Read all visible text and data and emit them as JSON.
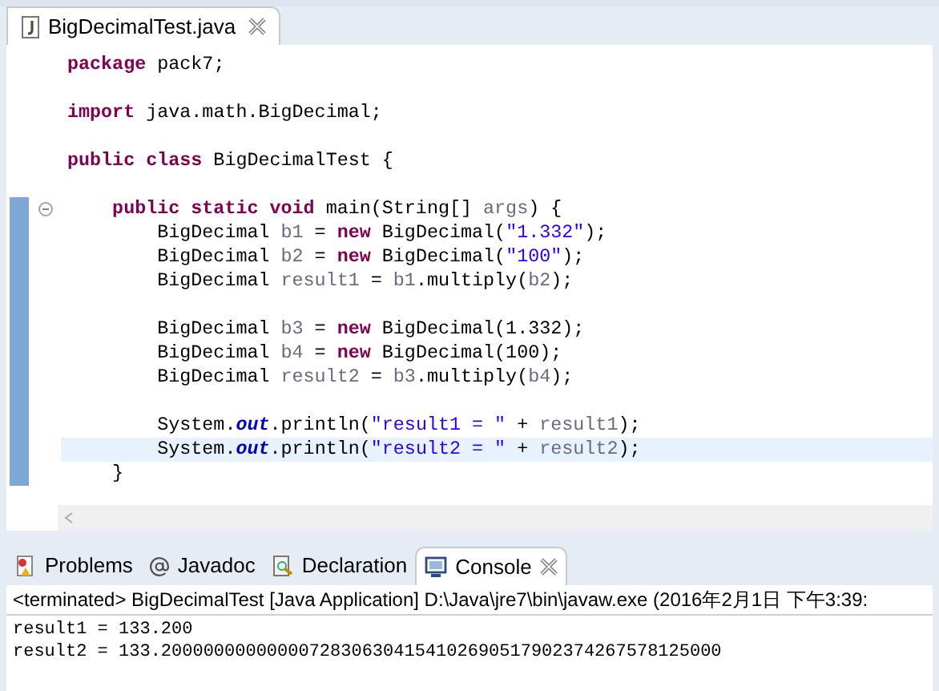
{
  "editor_tab": {
    "title": "BigDecimalTest.java"
  },
  "code_lines": [
    {
      "kind": "code",
      "current": false,
      "in_range": false,
      "foldable": false,
      "segments": [
        {
          "text": "package",
          "kind": "kw"
        },
        {
          "text": " pack7;",
          "kind": "plain"
        }
      ]
    },
    {
      "kind": "blank",
      "current": false,
      "in_range": false,
      "foldable": false
    },
    {
      "kind": "code",
      "current": false,
      "in_range": false,
      "foldable": false,
      "segments": [
        {
          "text": "import",
          "kind": "kw"
        },
        {
          "text": " java.math.BigDecimal;",
          "kind": "plain"
        }
      ]
    },
    {
      "kind": "blank",
      "current": false,
      "in_range": false,
      "foldable": false
    },
    {
      "kind": "code",
      "current": false,
      "in_range": false,
      "foldable": false,
      "segments": [
        {
          "text": "public class",
          "kind": "kw"
        },
        {
          "text": " BigDecimalTest {",
          "kind": "plain"
        }
      ]
    },
    {
      "kind": "blank",
      "current": false,
      "in_range": false,
      "foldable": false
    },
    {
      "kind": "code",
      "current": false,
      "in_range": true,
      "foldable": true,
      "segments": [
        {
          "text": "    public static void",
          "kind": "kw"
        },
        {
          "text": " main(String[] ",
          "kind": "plain"
        },
        {
          "text": "args",
          "kind": "var"
        },
        {
          "text": ") {",
          "kind": "plain"
        }
      ]
    },
    {
      "kind": "code",
      "current": false,
      "in_range": true,
      "foldable": false,
      "segments": [
        {
          "text": "        BigDecimal ",
          "kind": "plain"
        },
        {
          "text": "b1",
          "kind": "var"
        },
        {
          "text": " = ",
          "kind": "plain"
        },
        {
          "text": "new",
          "kind": "kw"
        },
        {
          "text": " BigDecimal(",
          "kind": "plain"
        },
        {
          "text": "\"1.332\"",
          "kind": "str"
        },
        {
          "text": ");",
          "kind": "plain"
        }
      ]
    },
    {
      "kind": "code",
      "current": false,
      "in_range": true,
      "foldable": false,
      "segments": [
        {
          "text": "        BigDecimal ",
          "kind": "plain"
        },
        {
          "text": "b2",
          "kind": "var"
        },
        {
          "text": " = ",
          "kind": "plain"
        },
        {
          "text": "new",
          "kind": "kw"
        },
        {
          "text": " BigDecimal(",
          "kind": "plain"
        },
        {
          "text": "\"100\"",
          "kind": "str"
        },
        {
          "text": ");",
          "kind": "plain"
        }
      ]
    },
    {
      "kind": "code",
      "current": false,
      "in_range": true,
      "foldable": false,
      "segments": [
        {
          "text": "        BigDecimal ",
          "kind": "plain"
        },
        {
          "text": "result1",
          "kind": "var"
        },
        {
          "text": " = ",
          "kind": "plain"
        },
        {
          "text": "b1",
          "kind": "var"
        },
        {
          "text": ".multiply(",
          "kind": "plain"
        },
        {
          "text": "b2",
          "kind": "var"
        },
        {
          "text": ");",
          "kind": "plain"
        }
      ]
    },
    {
      "kind": "blank",
      "current": false,
      "in_range": true,
      "foldable": false
    },
    {
      "kind": "code",
      "current": false,
      "in_range": true,
      "foldable": false,
      "segments": [
        {
          "text": "        BigDecimal ",
          "kind": "plain"
        },
        {
          "text": "b3",
          "kind": "var"
        },
        {
          "text": " = ",
          "kind": "plain"
        },
        {
          "text": "new",
          "kind": "kw"
        },
        {
          "text": " BigDecimal(1.332);",
          "kind": "plain"
        }
      ]
    },
    {
      "kind": "code",
      "current": false,
      "in_range": true,
      "foldable": false,
      "segments": [
        {
          "text": "        BigDecimal ",
          "kind": "plain"
        },
        {
          "text": "b4",
          "kind": "var"
        },
        {
          "text": " = ",
          "kind": "plain"
        },
        {
          "text": "new",
          "kind": "kw"
        },
        {
          "text": " BigDecimal(100);",
          "kind": "plain"
        }
      ]
    },
    {
      "kind": "code",
      "current": false,
      "in_range": true,
      "foldable": false,
      "segments": [
        {
          "text": "        BigDecimal ",
          "kind": "plain"
        },
        {
          "text": "result2",
          "kind": "var"
        },
        {
          "text": " = ",
          "kind": "plain"
        },
        {
          "text": "b3",
          "kind": "var"
        },
        {
          "text": ".multiply(",
          "kind": "plain"
        },
        {
          "text": "b4",
          "kind": "var"
        },
        {
          "text": ");",
          "kind": "plain"
        }
      ]
    },
    {
      "kind": "blank",
      "current": false,
      "in_range": true,
      "foldable": false
    },
    {
      "kind": "code",
      "current": false,
      "in_range": true,
      "foldable": false,
      "segments": [
        {
          "text": "        System.",
          "kind": "plain"
        },
        {
          "text": "out",
          "kind": "field"
        },
        {
          "text": ".println(",
          "kind": "plain"
        },
        {
          "text": "\"result1 = \"",
          "kind": "str"
        },
        {
          "text": " + ",
          "kind": "plain"
        },
        {
          "text": "result1",
          "kind": "var"
        },
        {
          "text": ");",
          "kind": "plain"
        }
      ]
    },
    {
      "kind": "code",
      "current": true,
      "in_range": true,
      "foldable": false,
      "segments": [
        {
          "text": "        System.",
          "kind": "plain"
        },
        {
          "text": "out",
          "kind": "field"
        },
        {
          "text": ".println(",
          "kind": "plain"
        },
        {
          "text": "\"result2 = \"",
          "kind": "str"
        },
        {
          "text": " + ",
          "kind": "plain"
        },
        {
          "text": "result2",
          "kind": "var"
        },
        {
          "text": ");",
          "kind": "plain"
        }
      ]
    },
    {
      "kind": "code",
      "current": false,
      "in_range": true,
      "foldable": false,
      "segments": [
        {
          "text": "    }",
          "kind": "plain"
        }
      ]
    }
  ],
  "views": {
    "tabs": [
      {
        "label": "Problems",
        "kind": "problems",
        "selected": false
      },
      {
        "label": "Javadoc",
        "kind": "javadoc",
        "selected": false
      },
      {
        "label": "Declaration",
        "kind": "declaration",
        "selected": false
      },
      {
        "label": "Console",
        "kind": "console",
        "selected": true
      }
    ]
  },
  "console": {
    "header": "<terminated> BigDecimalTest [Java Application] D:\\Java\\jre7\\bin\\javaw.exe (2016年2月1日 下午3:39:",
    "output": [
      "result1 = 133.200",
      "result2 = 133.20000000000000728306304154102690517902374267578125000"
    ]
  }
}
